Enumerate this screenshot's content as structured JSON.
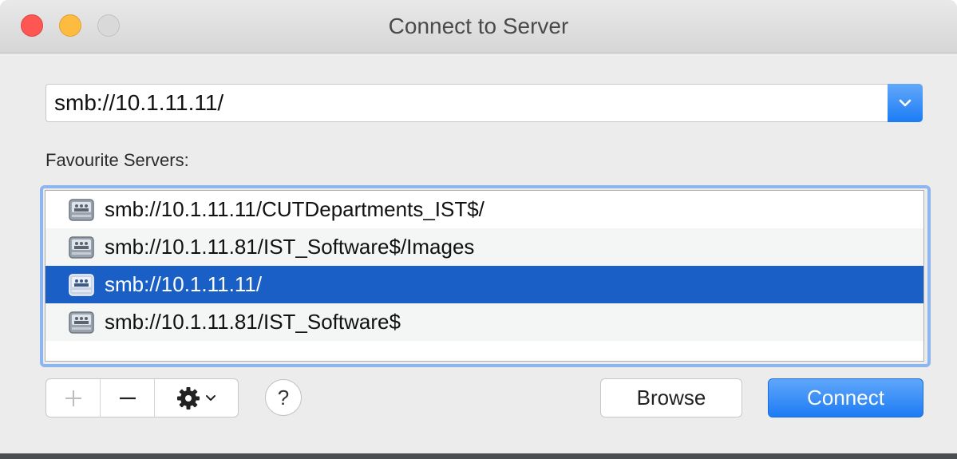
{
  "window": {
    "title": "Connect to Server"
  },
  "address": {
    "value": "smb://10.1.11.11/"
  },
  "favourites": {
    "label": "Favourite Servers:",
    "items": [
      {
        "url": "smb://10.1.11.11/CUTDepartments_IST$/",
        "selected": false
      },
      {
        "url": "smb://10.1.11.81/IST_Software$/Images",
        "selected": false
      },
      {
        "url": "smb://10.1.11.11/",
        "selected": true
      },
      {
        "url": "smb://10.1.11.81/IST_Software$",
        "selected": false
      }
    ]
  },
  "toolbar": {
    "add_icon": "plus-icon",
    "remove_icon": "minus-icon",
    "action_icon": "gear-icon",
    "help_label": "?"
  },
  "buttons": {
    "browse_label": "Browse",
    "connect_label": "Connect"
  },
  "colors": {
    "accent": "#1d7bf3",
    "selection": "#1a5fc6",
    "close": "#fc5753",
    "minimize": "#fdbc40",
    "zoom": "#d9d9d9"
  }
}
